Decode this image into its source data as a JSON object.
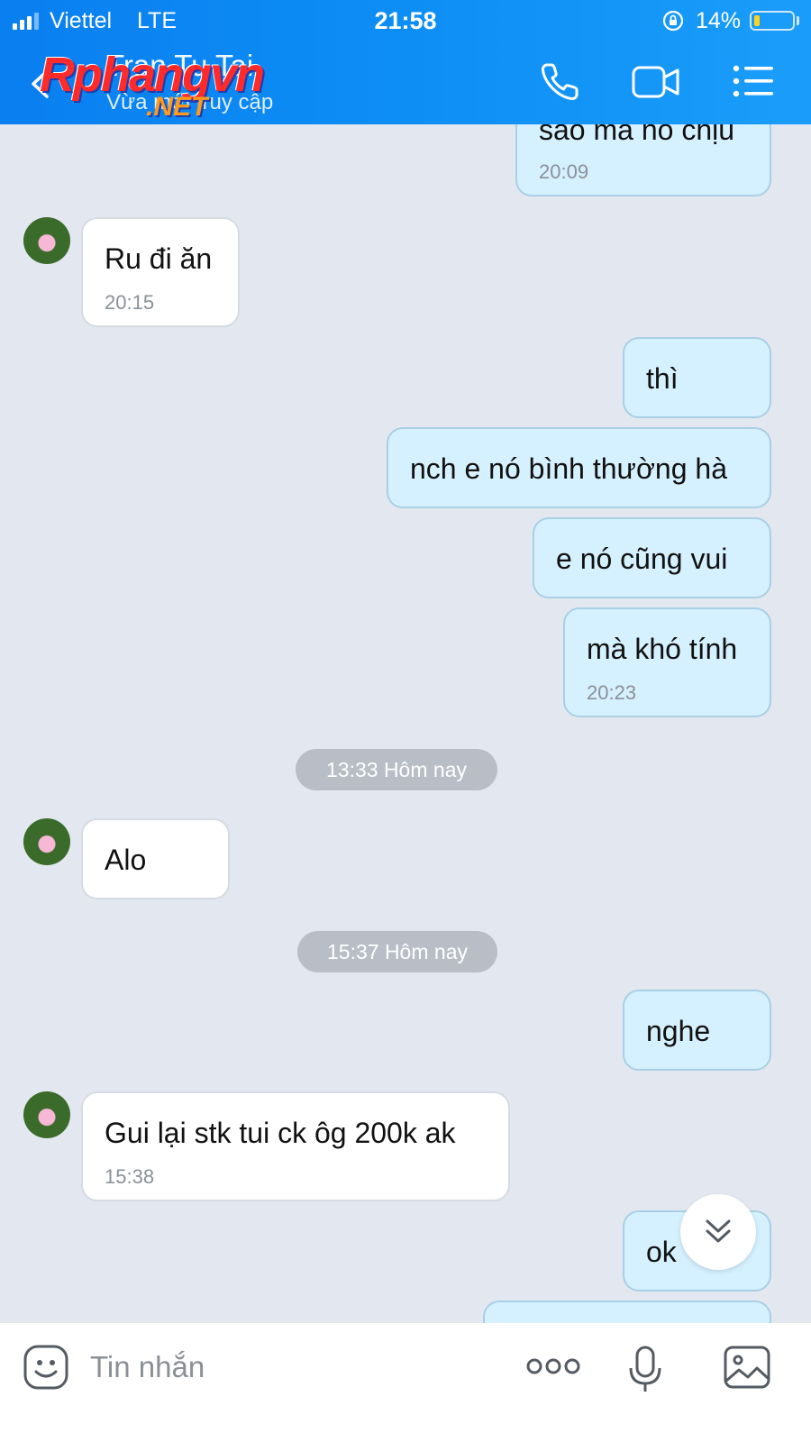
{
  "status_bar": {
    "carrier": "Viettel",
    "network": "LTE",
    "time": "21:58",
    "battery": "14%",
    "battery_level": 0.14
  },
  "header": {
    "contact_name": "Tran Tu Tai",
    "contact_status": "Vừa mới truy cập",
    "watermark_main": "Rphangvn",
    "watermark_sub": ".NET",
    "icons": [
      "back-icon",
      "phone-icon",
      "video-icon",
      "menu-icon"
    ]
  },
  "messages": {
    "m0": {
      "text": "sao mà nó chịu",
      "time": "20:09",
      "side": "out"
    },
    "m1": {
      "text": "Ru đi ăn",
      "time": "20:15",
      "side": "in"
    },
    "m2": {
      "text": "thì",
      "side": "out"
    },
    "m3": {
      "text": "nch e nó bình thường hà",
      "side": "out"
    },
    "m4": {
      "text": "e nó cũng vui",
      "side": "out"
    },
    "m5": {
      "text": "mà khó tính",
      "time": "20:23",
      "side": "out"
    },
    "d1": {
      "text": "13:33 Hôm nay"
    },
    "m6": {
      "text": "Alo",
      "side": "in"
    },
    "d2": {
      "text": "15:37 Hôm nay"
    },
    "m7": {
      "text": "nghe",
      "side": "out"
    },
    "m8": {
      "text": "Gui lại stk tui ck ôg 200k ak",
      "time": "15:38",
      "side": "in"
    },
    "m9": {
      "text": "ok",
      "side": "out"
    }
  },
  "composer": {
    "placeholder": "Tin nhắn",
    "icons": [
      "sticker-icon",
      "more-icon",
      "microphone-icon",
      "image-icon"
    ]
  },
  "colors": {
    "header": "#0d8ef5",
    "outgoing_bubble": "#d5f0ff",
    "incoming_bubble": "#ffffff",
    "background": "#e3e8f0"
  }
}
